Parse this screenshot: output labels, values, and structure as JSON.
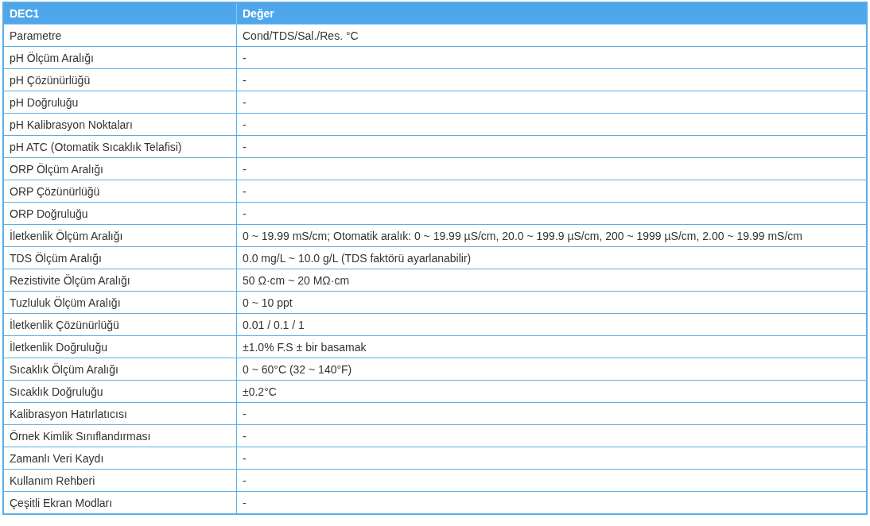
{
  "table": {
    "columns": [
      "DEC1",
      "Değer"
    ],
    "rows": [
      [
        "Parametre",
        "Cond/TDS/Sal./Res. °C"
      ],
      [
        "pH Ölçüm Aralığı",
        "-"
      ],
      [
        "pH Çözünürlüğü",
        "-"
      ],
      [
        "pH Doğruluğu",
        "-"
      ],
      [
        "pH Kalibrasyon Noktaları",
        "-"
      ],
      [
        "pH ATC (Otomatik Sıcaklık Telafisi)",
        "-"
      ],
      [
        "ORP Ölçüm Aralığı",
        "-"
      ],
      [
        "ORP Çözünürlüğü",
        "-"
      ],
      [
        "ORP Doğruluğu",
        "-"
      ],
      [
        "İletkenlik Ölçüm Aralığı",
        "0 ~ 19.99 mS/cm; Otomatik aralık: 0 ~ 19.99 µS/cm, 20.0 ~ 199.9 µS/cm, 200 ~ 1999 µS/cm, 2.00 ~ 19.99 mS/cm"
      ],
      [
        "TDS Ölçüm Aralığı",
        "0.0 mg/L ~ 10.0 g/L (TDS faktörü ayarlanabilir)"
      ],
      [
        "Rezistivite Ölçüm Aralığı",
        "50 Ω·cm ~ 20 MΩ·cm"
      ],
      [
        "Tuzluluk Ölçüm Aralığı",
        "0 ~ 10 ppt"
      ],
      [
        "İletkenlik Çözünürlüğü",
        "0.01 / 0.1 / 1"
      ],
      [
        "İletkenlik Doğruluğu",
        "±1.0% F.S ± bir basamak"
      ],
      [
        "Sıcaklık Ölçüm Aralığı",
        "0 ~ 60°C (32 ~ 140°F)"
      ],
      [
        "Sıcaklık Doğruluğu",
        "±0.2°C"
      ],
      [
        "Kalibrasyon Hatırlatıcısı",
        "-"
      ],
      [
        "Örnek Kimlik Sınıflandırması",
        "-"
      ],
      [
        "Zamanlı Veri Kaydı",
        "-"
      ],
      [
        "Kullanım Rehberi",
        "-"
      ],
      [
        "Çeşitli Ekran Modları",
        "-"
      ]
    ]
  }
}
